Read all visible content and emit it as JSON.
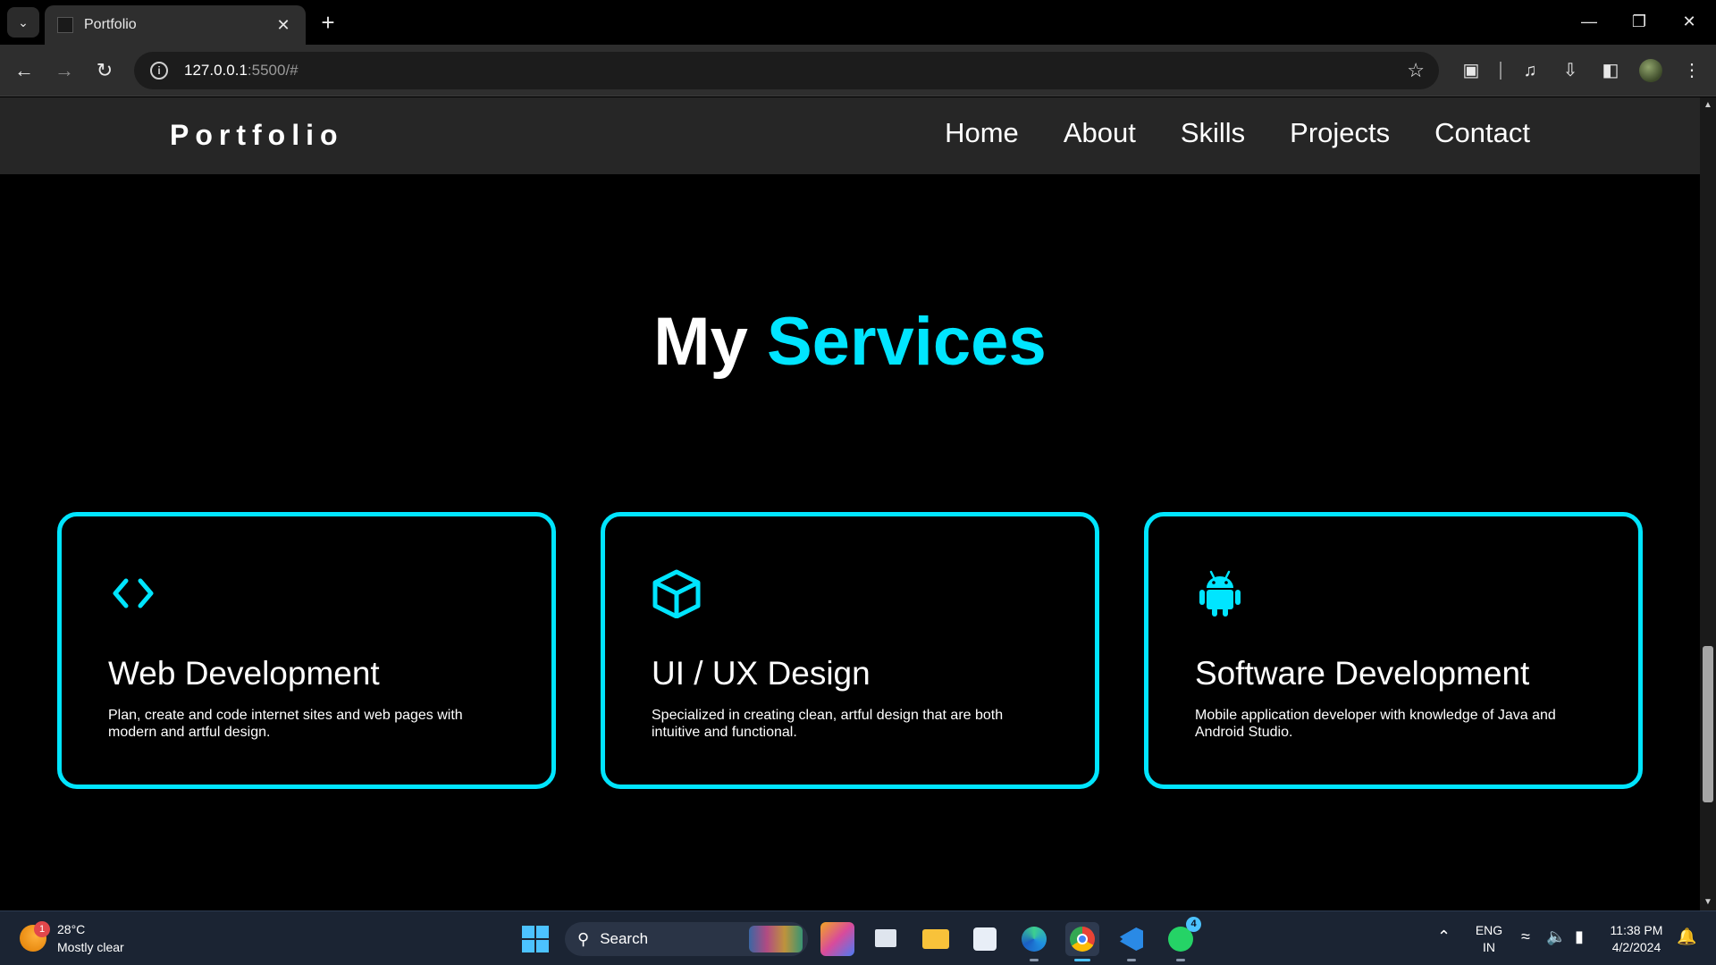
{
  "browser": {
    "tab_title": "Portfolio",
    "url_host": "127.0.0.1",
    "url_rest": ":5500/#"
  },
  "site": {
    "logo": "Portfolio",
    "nav": [
      "Home",
      "About",
      "Skills",
      "Projects",
      "Contact"
    ]
  },
  "services": {
    "title_plain": "My",
    "title_accent": "Services",
    "cards": [
      {
        "icon": "code-icon",
        "title": "Web Development",
        "desc": "Plan, create and code internet sites and web pages with modern and artful design."
      },
      {
        "icon": "cube-icon",
        "title": "UI / UX Design",
        "desc": "Specialized in creating clean, artful design that are both intuitive and functional."
      },
      {
        "icon": "android-icon",
        "title": "Software Development",
        "desc": "Mobile application developer with knowledge of Java and Android Studio."
      }
    ]
  },
  "colors": {
    "accent": "#00e5ff",
    "header_bg": "#262626",
    "page_bg": "#000000"
  },
  "taskbar": {
    "weather_temp": "28°C",
    "weather_desc": "Mostly clear",
    "weather_badge": "1",
    "search_label": "Search",
    "whatsapp_badge": "4",
    "lang_line1": "ENG",
    "lang_line2": "IN",
    "time": "11:38 PM",
    "date": "4/2/2024"
  }
}
